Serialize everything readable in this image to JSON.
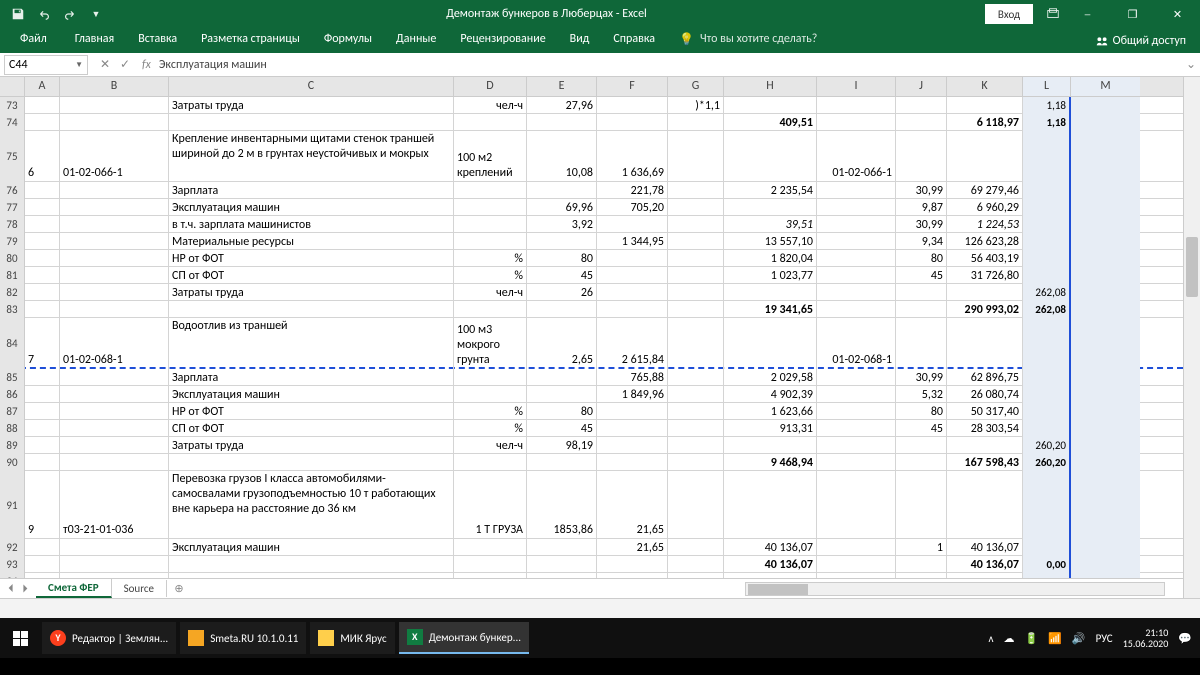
{
  "title": "Демонтаж бункеров в Люберцах  -  Excel",
  "login": "Вход",
  "ribbon": {
    "file": "Файл",
    "home": "Главная",
    "insert": "Вставка",
    "layout": "Разметка страницы",
    "formulas": "Формулы",
    "data": "Данные",
    "review": "Рецензирование",
    "view": "Вид",
    "help": "Справка",
    "tell": "Что вы хотите сделать?",
    "share": "Общий доступ"
  },
  "namebox": "C44",
  "formula": "Эксплуатация машин",
  "cols": [
    "A",
    "B",
    "C",
    "D",
    "E",
    "F",
    "G",
    "H",
    "I",
    "J",
    "K",
    "L",
    "M"
  ],
  "rows": [
    {
      "n": "73",
      "C": "Затраты труда",
      "D": "чел-ч",
      "E": "27,96",
      "G": ")*1,1",
      "L": "1,18"
    },
    {
      "n": "74",
      "H": "409,51",
      "Hb": true,
      "K": "6 118,97",
      "Kb": true,
      "L": "1,18",
      "Lb": true
    },
    {
      "n": "75",
      "h": 3,
      "A": "6",
      "B": "01-02-066-1",
      "C": "Крепление инвентарными щитами стенок траншей шириной до 2 м в грунтах неустойчивых и мокрых",
      "D": "100 м2 креплений",
      "E": "10,08",
      "F": "1 636,69",
      "I": "01-02-066-1"
    },
    {
      "n": "76",
      "C": "Зарплата",
      "F": "221,78",
      "H": "2 235,54",
      "J": "30,99",
      "K": "69 279,46"
    },
    {
      "n": "77",
      "C": "Эксплуатация машин",
      "E": "69,96",
      "F": "705,20",
      "J": "9,87",
      "K": "6 960,29"
    },
    {
      "n": "78",
      "C": "в т.ч. зарплата машинистов",
      "E": "3,92",
      "H": "39,51",
      "Hi": true,
      "J": "30,99",
      "K": "1 224,53",
      "Ki": true
    },
    {
      "n": "79",
      "C": "Материальные ресурсы",
      "F": "1 344,95",
      "H": "13 557,10",
      "J": "9,34",
      "K": "126 623,28"
    },
    {
      "n": "80",
      "C": "НР от ФОТ",
      "D": "%",
      "E": "80",
      "H": "1 820,04",
      "J": "80",
      "K": "56 403,19"
    },
    {
      "n": "81",
      "C": "СП от ФОТ",
      "D": "%",
      "E": "45",
      "H": "1 023,77",
      "J": "45",
      "K": "31 726,80"
    },
    {
      "n": "82",
      "C": "Затраты труда",
      "D": "чел-ч",
      "E": "26",
      "L": "262,08"
    },
    {
      "n": "83",
      "H": "19 341,65",
      "Hb": true,
      "K": "290 993,02",
      "Kb": true,
      "L": "262,08",
      "Lb": true
    },
    {
      "n": "84",
      "h": 3,
      "A": "7",
      "B": "01-02-068-1",
      "C": "Водоотлив из траншей",
      "D": "100 м3 мокрого грунта",
      "E": "2,65",
      "F": "2 615,84",
      "I": "01-02-068-1",
      "dash": true
    },
    {
      "n": "85",
      "C": "Зарплата",
      "F": "765,88",
      "H": "2 029,58",
      "J": "30,99",
      "K": "62 896,75"
    },
    {
      "n": "86",
      "C": "Эксплуатация машин",
      "F": "1 849,96",
      "H": "4 902,39",
      "J": "5,32",
      "K": "26 080,74"
    },
    {
      "n": "87",
      "C": "НР от ФОТ",
      "D": "%",
      "E": "80",
      "H": "1 623,66",
      "J": "80",
      "K": "50 317,40"
    },
    {
      "n": "88",
      "C": "СП от ФОТ",
      "D": "%",
      "E": "45",
      "H": "913,31",
      "J": "45",
      "K": "28 303,54"
    },
    {
      "n": "89",
      "C": "Затраты труда",
      "D": "чел-ч",
      "E": "98,19",
      "L": "260,20"
    },
    {
      "n": "90",
      "H": "9 468,94",
      "Hb": true,
      "K": "167 598,43",
      "Kb": true,
      "L": "260,20",
      "Lb": true
    },
    {
      "n": "91",
      "h": 4,
      "A": "9",
      "B": "т03-21-01-036",
      "C": "Перевозка грузов I класса автомобилями-самосвалами грузоподъемностью 10 т работающих вне карьера на расстояние до 36 км",
      "D": "1 Т ГРУЗА",
      "E": "1853,86",
      "F": "21,65"
    },
    {
      "n": "92",
      "C": "Эксплуатация машин",
      "F": "21,65",
      "H": "40 136,07",
      "J": "1",
      "K": "40 136,07"
    },
    {
      "n": "93",
      "H": "40 136,07",
      "Hb": true,
      "K": "40 136,07",
      "Kb": true,
      "L": "0,00",
      "Lb": true
    },
    {
      "n": "94"
    }
  ],
  "sheets": {
    "active": "Смета ФЕР",
    "other": "Source"
  },
  "taskbar": {
    "items": [
      {
        "label": "Редактор | Землян...",
        "type": "y"
      },
      {
        "label": "Smeta.RU  10.1.0.11",
        "type": "s"
      },
      {
        "label": "МИК Ярус",
        "type": "f"
      },
      {
        "label": "Демонтаж бункер...",
        "type": "x",
        "active": true
      }
    ],
    "lang": "РУС",
    "time": "21:10",
    "date": "15.06.2020"
  }
}
